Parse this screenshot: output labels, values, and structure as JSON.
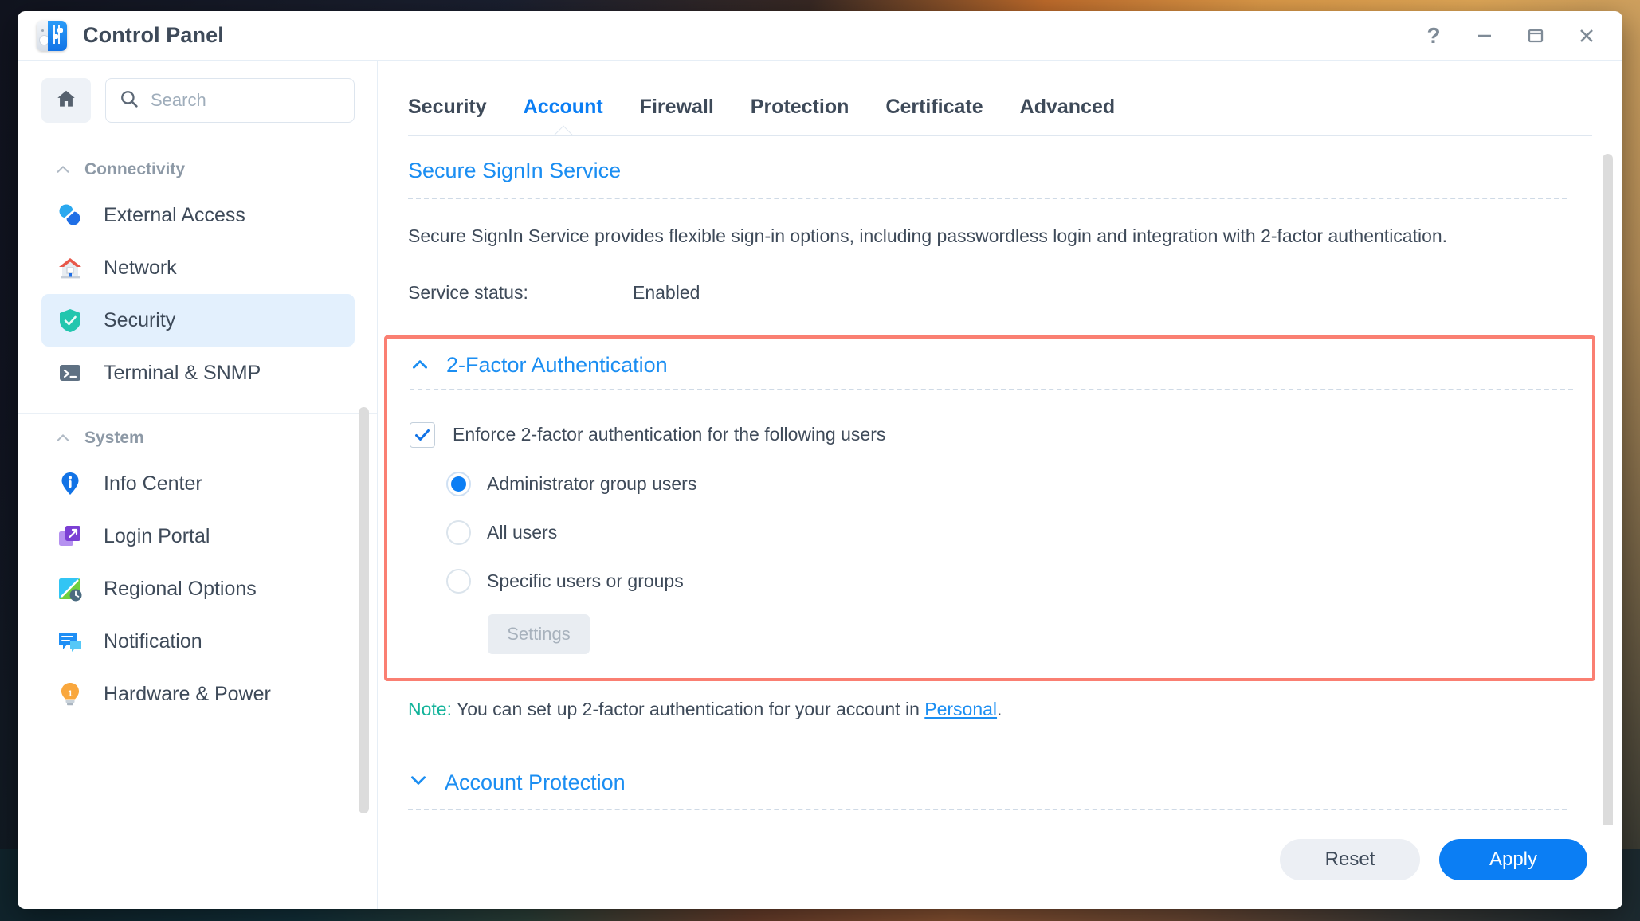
{
  "window": {
    "title": "Control Panel",
    "app_icon": "control-panel-sliders-icon",
    "controls": {
      "help": "?",
      "minimize": "—",
      "maximize": "□",
      "close": "✕"
    }
  },
  "sidebar": {
    "home_icon": "home-icon",
    "search": {
      "placeholder": "Search",
      "value": ""
    },
    "groups": [
      {
        "label": "Connectivity",
        "items": [
          {
            "label": "External Access",
            "icon": "external-access-icon",
            "active": false
          },
          {
            "label": "Network",
            "icon": "network-house-icon",
            "active": false
          },
          {
            "label": "Security",
            "icon": "security-shield-icon",
            "active": true
          },
          {
            "label": "Terminal & SNMP",
            "icon": "terminal-icon",
            "active": false
          }
        ]
      },
      {
        "label": "System",
        "items": [
          {
            "label": "Info Center",
            "icon": "info-center-icon",
            "active": false
          },
          {
            "label": "Login Portal",
            "icon": "login-portal-icon",
            "active": false
          },
          {
            "label": "Regional Options",
            "icon": "regional-options-icon",
            "active": false
          },
          {
            "label": "Notification",
            "icon": "notification-icon",
            "active": false
          },
          {
            "label": "Hardware & Power",
            "icon": "hardware-power-bulb-icon",
            "active": false
          }
        ]
      }
    ]
  },
  "main": {
    "tabs": [
      {
        "label": "Security",
        "active": false
      },
      {
        "label": "Account",
        "active": true
      },
      {
        "label": "Firewall",
        "active": false
      },
      {
        "label": "Protection",
        "active": false
      },
      {
        "label": "Certificate",
        "active": false
      },
      {
        "label": "Advanced",
        "active": false
      }
    ],
    "secure_signin": {
      "title": "Secure SignIn Service",
      "description": "Secure SignIn Service provides flexible sign-in options, including passwordless login and integration with 2-factor authentication.",
      "status_label": "Service status:",
      "status_value": "Enabled"
    },
    "two_factor": {
      "title": "2-Factor Authentication",
      "collapse_icon": "chevron-up-icon",
      "highlighted": true,
      "highlight_color": "#fa7f72",
      "checkbox": {
        "label": "Enforce 2-factor authentication for the following users",
        "checked": true
      },
      "radios": [
        {
          "label": "Administrator group users",
          "selected": true
        },
        {
          "label": "All users",
          "selected": false
        },
        {
          "label": "Specific users or groups",
          "selected": false
        }
      ],
      "settings_button": {
        "label": "Settings",
        "disabled": true
      }
    },
    "note": {
      "key": "Note:",
      "text_before": " You can set up 2-factor authentication for your account in ",
      "link": "Personal",
      "text_after": "."
    },
    "account_protection": {
      "title": "Account Protection",
      "collapse_icon": "chevron-down-icon"
    }
  },
  "footer": {
    "reset_label": "Reset",
    "apply_label": "Apply"
  },
  "colors": {
    "accent_blue": "#0b7ef4",
    "link_blue": "#1b8ef2",
    "highlight_red": "#fa7f72",
    "note_teal": "#12b39a",
    "text": "#3e4a59"
  }
}
